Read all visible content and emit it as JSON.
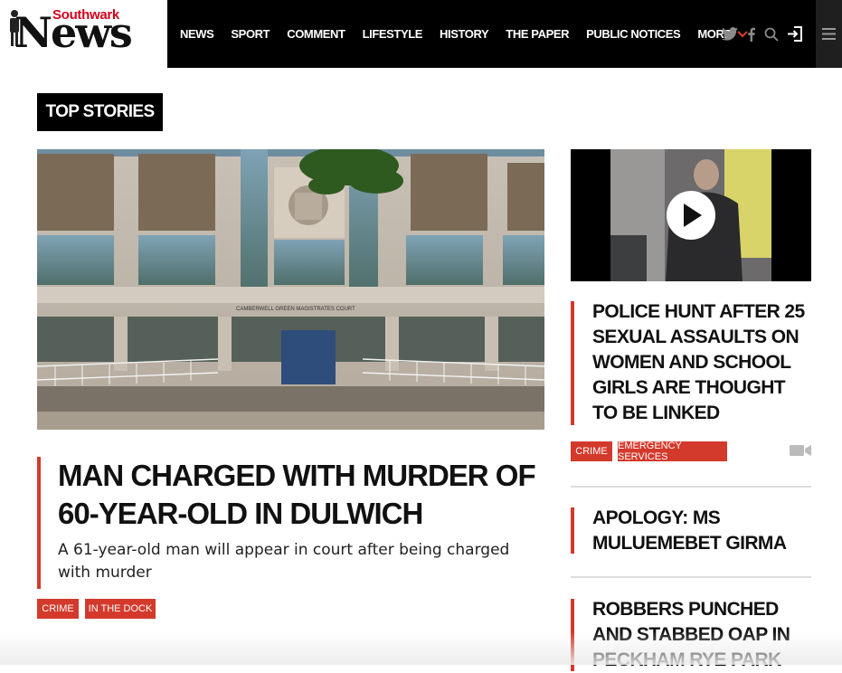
{
  "brand": {
    "small": "Southwark",
    "big": "News",
    "accent_color": "#d33a2c"
  },
  "nav": {
    "items": [
      "NEWS",
      "SPORT",
      "COMMENT",
      "LIFESTYLE",
      "HISTORY",
      "THE PAPER",
      "PUBLIC NOTICES"
    ],
    "more_label": "MORE"
  },
  "section": {
    "title": "TOP STORIES"
  },
  "main_story": {
    "image_text": "CAMBERWELL GREEN MAGISTRATES COURT",
    "headline": "MAN CHARGED WITH MURDER OF 60-YEAR-OLD IN DULWICH",
    "standfirst": "A 61-year-old man will appear in court after being charged with murder",
    "tags": [
      "CRIME",
      "IN THE DOCK"
    ]
  },
  "side_stories": [
    {
      "headline": "POLICE HUNT AFTER 25 SEXUAL ASSAULTS ON WOMEN AND SCHOOL GIRLS ARE THOUGHT TO BE LINKED",
      "tags": [
        "CRIME",
        "EMERGENCY SERVICES"
      ],
      "media": "video-camera-icon"
    },
    {
      "headline": "APOLOGY: MS MULUEMEBET GIRMA"
    },
    {
      "headline": "ROBBERS PUNCHED AND STABBED OAP IN PECKHAM RYE PARK"
    }
  ]
}
